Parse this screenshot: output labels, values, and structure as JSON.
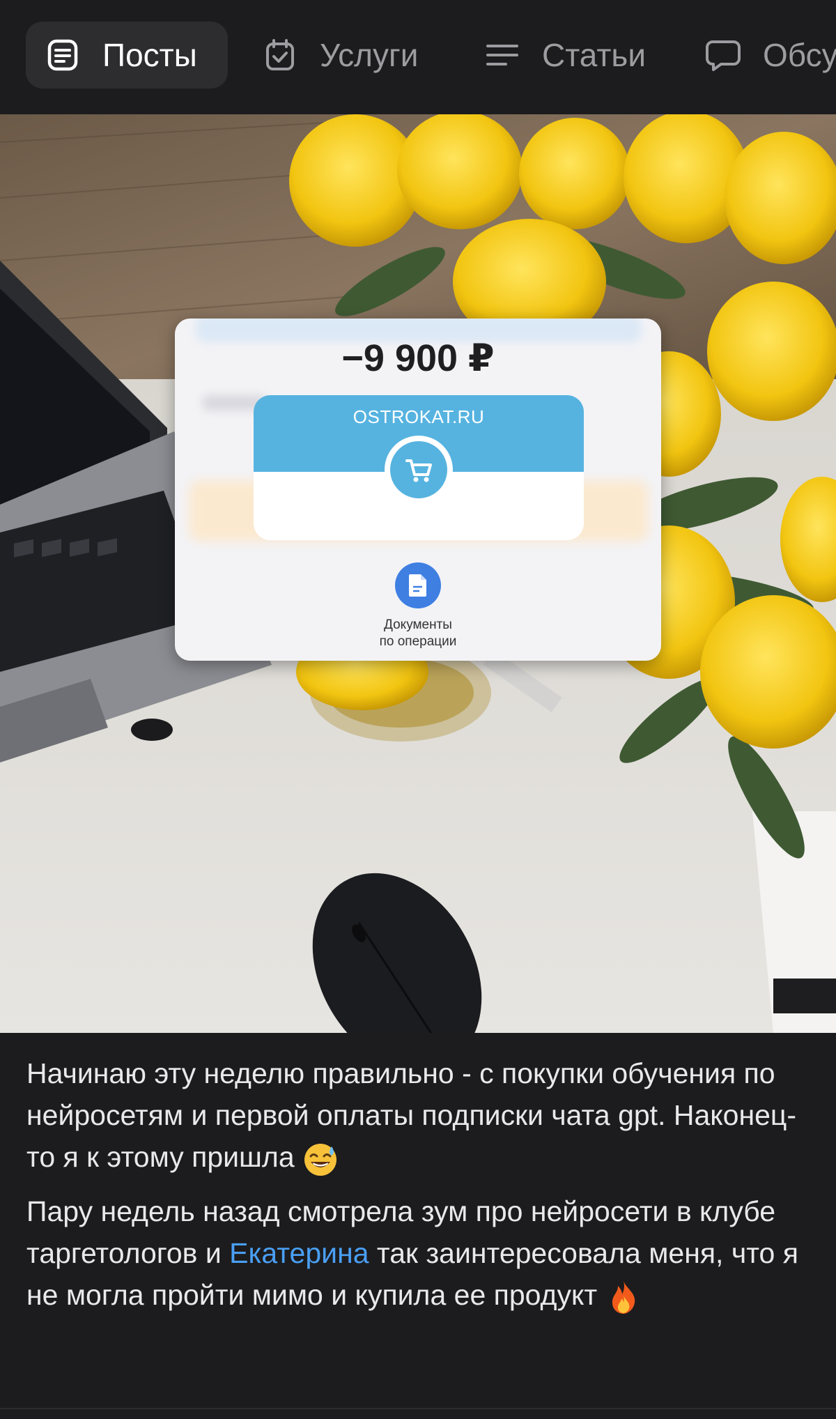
{
  "tabs": [
    {
      "label": "Посты",
      "icon": "document-lines-icon",
      "active": true
    },
    {
      "label": "Услуги",
      "icon": "calendar-check-icon",
      "active": false
    },
    {
      "label": "Статьи",
      "icon": "text-lines-icon",
      "active": false
    },
    {
      "label": "Обсуждения",
      "icon": "chat-bubble-icon",
      "active": false
    }
  ],
  "receipt": {
    "amount": "−9 900 ₽",
    "merchant": "OSTROKAT.RU",
    "merchant_icon": "cart-icon",
    "documents_label_line1": "Документы",
    "documents_label_line2": "по операции"
  },
  "post": {
    "paragraph1": "Начинаю эту неделю правильно - с покупки обучения по нейросетям и первой оплаты подписки чата gpt. Наконец-то я к этому пришла",
    "paragraph1_emoji": "sweat-smile-emoji",
    "paragraph2_before": "Пару недель назад смотрела зум про нейросети в клубе таргетологов и ",
    "paragraph2_link": "Екатерина",
    "paragraph2_after": " так заинтересовала меня, что я не могла пройти мимо и купила ее продукт ",
    "paragraph2_emoji": "fire-emoji"
  },
  "colors": {
    "background": "#1c1c1e",
    "active_tab": "#2d2d30",
    "link": "#4a9ff5",
    "merchant_band": "#56b3e0",
    "doc_button": "#3f7fe2"
  }
}
